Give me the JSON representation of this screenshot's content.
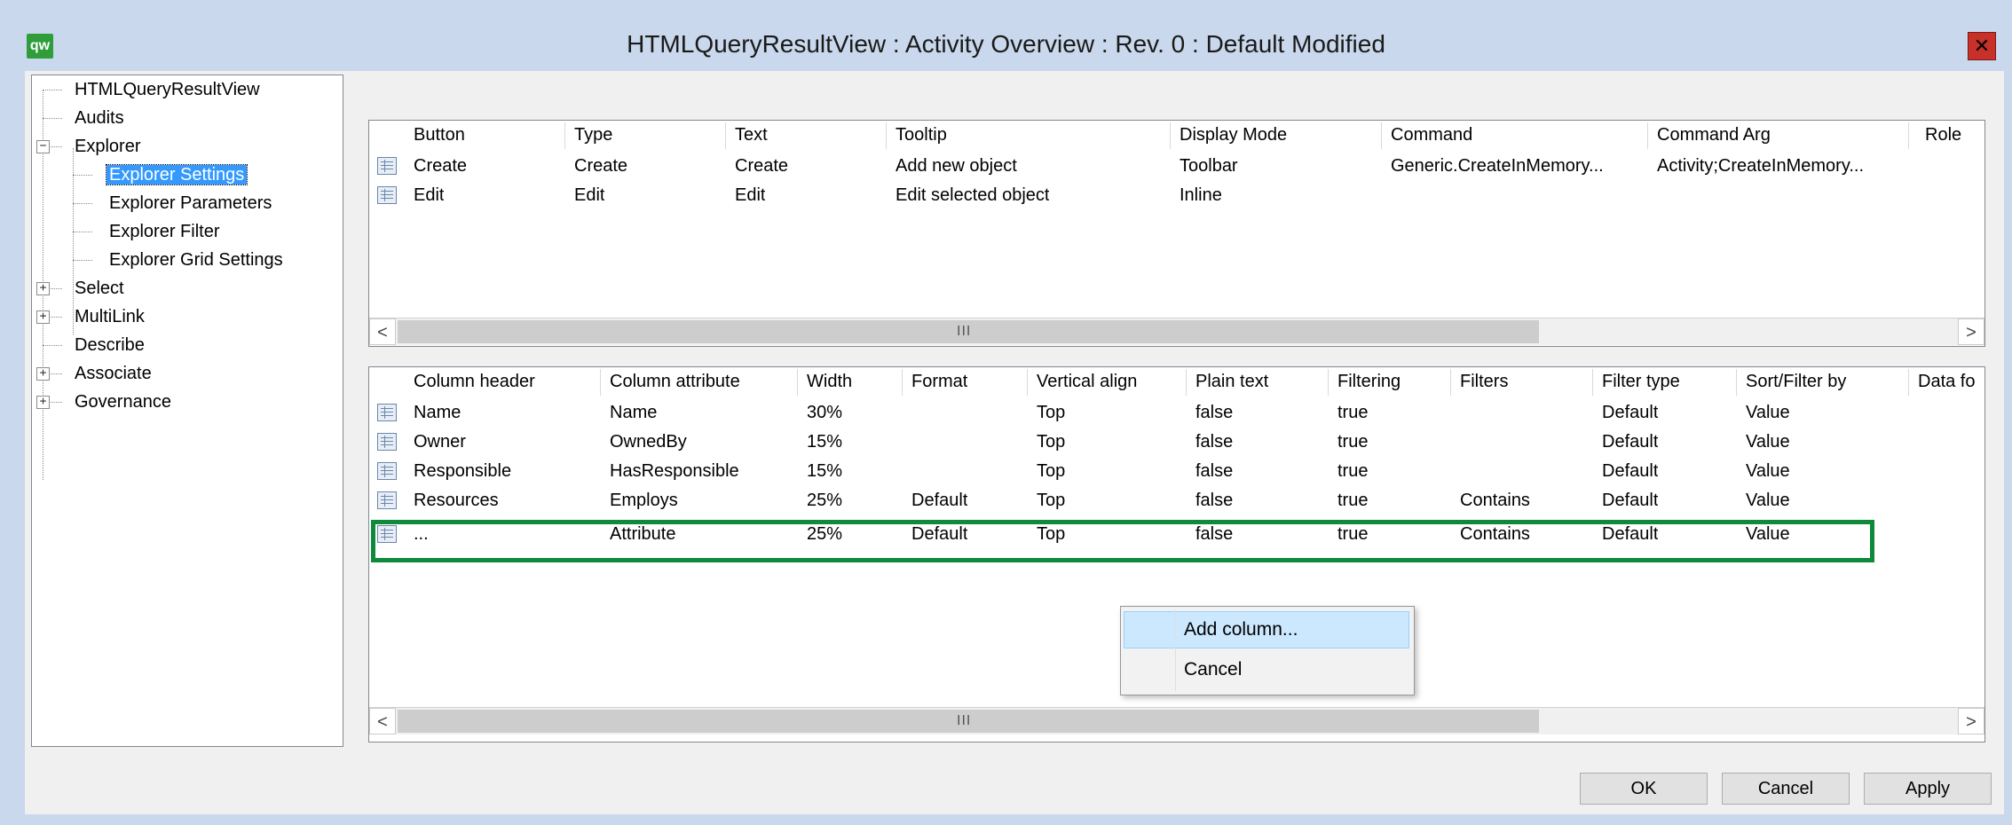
{
  "window": {
    "title": "HTMLQueryResultView : Activity Overview : Rev. 0 : Default Modified",
    "app_icon_text": "qw",
    "close_symbol": "✕"
  },
  "tree": {
    "items": [
      {
        "label": "HTMLQueryResultView"
      },
      {
        "label": "Audits"
      },
      {
        "label": "Explorer",
        "expander": "−"
      },
      {
        "label": "Explorer Settings",
        "selected": true
      },
      {
        "label": "Explorer Parameters"
      },
      {
        "label": "Explorer Filter"
      },
      {
        "label": "Explorer Grid Settings"
      },
      {
        "label": "Select",
        "expander": "+"
      },
      {
        "label": "MultiLink",
        "expander": "+"
      },
      {
        "label": "Describe"
      },
      {
        "label": "Associate",
        "expander": "+"
      },
      {
        "label": "Governance",
        "expander": "+"
      }
    ]
  },
  "buttons_grid": {
    "headers": [
      "Button",
      "Type",
      "Text",
      "Tooltip",
      "Display Mode",
      "Command",
      "Command Arg",
      "Role"
    ],
    "rows": [
      [
        "Create",
        "Create",
        "Create",
        "Add new object",
        "Toolbar",
        "Generic.CreateInMemory...",
        "Activity;CreateInMemory...",
        ""
      ],
      [
        "Edit",
        "Edit",
        "Edit",
        "Edit selected object",
        "Inline",
        "",
        "",
        ""
      ]
    ],
    "scroll": {
      "left": "<",
      "right": ">",
      "grip": "III"
    }
  },
  "columns_grid": {
    "headers": [
      "Column header",
      "Column attribute",
      "Width",
      "Format",
      "Vertical align",
      "Plain text",
      "Filtering",
      "Filters",
      "Filter type",
      "Sort/Filter by",
      "Data fo"
    ],
    "rows": [
      [
        "Name",
        "Name",
        "30%",
        "",
        "Top",
        "false",
        "true",
        "",
        "Default",
        "Value",
        ""
      ],
      [
        "Owner",
        "OwnedBy",
        "15%",
        "",
        "Top",
        "false",
        "true",
        "",
        "Default",
        "Value",
        ""
      ],
      [
        "Responsible",
        "HasResponsible",
        "15%",
        "",
        "Top",
        "false",
        "true",
        "",
        "Default",
        "Value",
        ""
      ],
      [
        "Resources",
        "Employs",
        "25%",
        "Default",
        "Top",
        "false",
        "true",
        "Contains",
        "Default",
        "Value",
        ""
      ],
      [
        "...",
        "Attribute",
        "25%",
        "Default",
        "Top",
        "false",
        "true",
        "Contains",
        "Default",
        "Value",
        ""
      ]
    ],
    "scroll": {
      "left": "<",
      "right": ">",
      "grip": "III"
    }
  },
  "context_menu": {
    "items": [
      "Add column...",
      "Cancel"
    ]
  },
  "footer": {
    "ok": "OK",
    "cancel": "Cancel",
    "apply": "Apply"
  },
  "colors": {
    "highlight": "#0e8a3a",
    "selection": "#3399ff",
    "titlebar": "#c9d8ec"
  }
}
